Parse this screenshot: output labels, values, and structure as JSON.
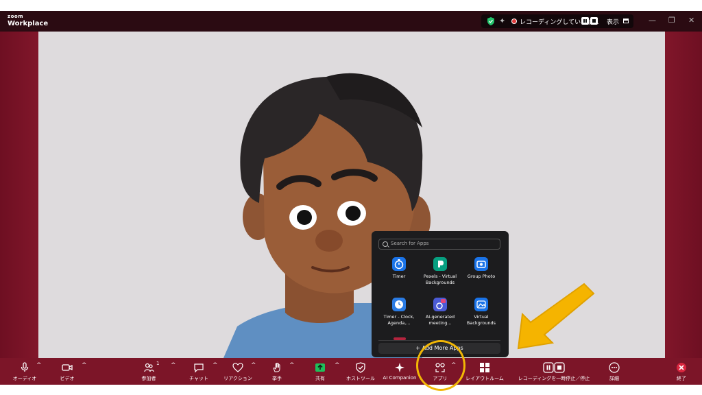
{
  "titlebar": {
    "logo_small": "zoom",
    "logo_main": "Workplace",
    "recording_text": "レコーディングしています...",
    "view_label": "表示",
    "minimize": "—",
    "restore": "❐",
    "close": "✕"
  },
  "apps_panel": {
    "search_placeholder": "Search for Apps",
    "apps": [
      {
        "label": "Timer",
        "icon": "stopwatch-icon",
        "color": "#1a73e8"
      },
      {
        "label": "Pexels - Virtual Backgrounds",
        "icon": "pexels-icon",
        "color": "#07a081"
      },
      {
        "label": "Group Photo",
        "icon": "camera-icon",
        "color": "#1a73e8"
      },
      {
        "label": "Timer - Clock, Agenda,...",
        "icon": "clock-icon",
        "color": "#2a7be4"
      },
      {
        "label": "AI-generated meeting...",
        "icon": "ai-meeting-icon",
        "color": "#4b5bd6"
      },
      {
        "label": "Virtual Backgrounds",
        "icon": "landscape-icon",
        "color": "#1a73e8"
      }
    ],
    "add_more_label": "+ Add More Apps"
  },
  "toolbar": {
    "audio": "オーディオ",
    "video": "ビデオ",
    "participants": "参加者",
    "participants_count": "1",
    "chat": "チャット",
    "reactions": "リアクション",
    "raise_hand": "挙手",
    "share": "共有",
    "host_tools": "ホストツール",
    "ai_companion": "AI Companion",
    "apps": "アプリ",
    "layout_room": "レイアウトルーム",
    "recording_pause_stop": "レコーディングを一時停止／停止",
    "details": "詳細",
    "end": "終了",
    "caret": "^"
  },
  "colors": {
    "accent_frame": "#7c1528",
    "highlight": "#f2b705",
    "share_green": "#1fbf5a",
    "end_red": "#d9263f"
  }
}
